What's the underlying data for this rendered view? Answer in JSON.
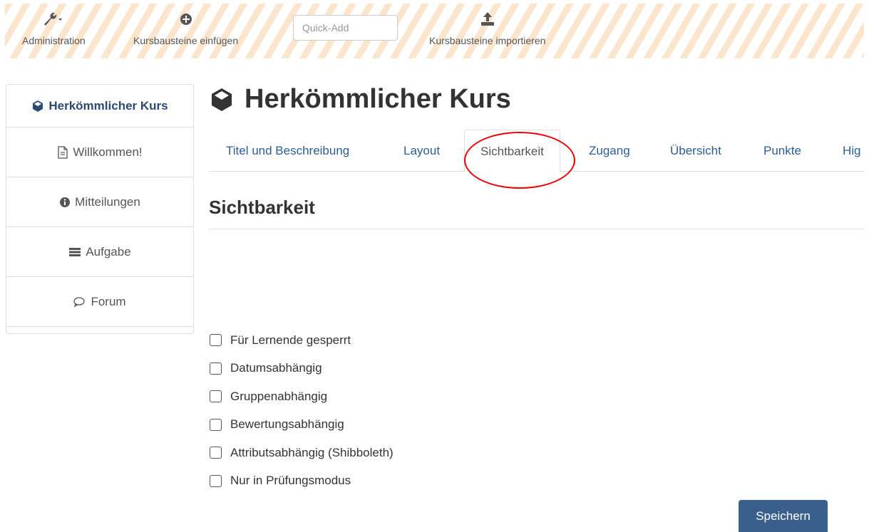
{
  "toolbar": {
    "administration_label": "Administration",
    "einfuegen_label": "Kursbausteine einfügen",
    "quickadd_placeholder": "Quick-Add",
    "importieren_label": "Kursbausteine importieren"
  },
  "sidebar": {
    "course_title": "Herkömmlicher Kurs",
    "items": [
      {
        "label": "Willkommen!",
        "icon": "document-icon"
      },
      {
        "label": "Mitteilungen",
        "icon": "info-icon"
      },
      {
        "label": "Aufgabe",
        "icon": "task-icon"
      },
      {
        "label": "Forum",
        "icon": "forum-icon"
      }
    ]
  },
  "main": {
    "title": "Herkömmlicher Kurs",
    "tabs": [
      {
        "label": "Titel und Beschreibung"
      },
      {
        "label": "Layout"
      },
      {
        "label": "Sichtbarkeit",
        "active": true
      },
      {
        "label": "Zugang"
      },
      {
        "label": "Übersicht"
      },
      {
        "label": "Punkte"
      },
      {
        "label": "Hig"
      }
    ],
    "section_title": "Sichtbarkeit",
    "checkboxes": [
      {
        "label": "Für Lernende gesperrt",
        "checked": false
      },
      {
        "label": "Datumsabhängig",
        "checked": false
      },
      {
        "label": "Gruppenabhängig",
        "checked": false
      },
      {
        "label": "Bewertungsabhängig",
        "checked": false
      },
      {
        "label": "Attributsabhängig (Shibboleth)",
        "checked": false
      },
      {
        "label": "Nur in Prüfungsmodus",
        "checked": false
      }
    ],
    "save_label": "Speichern"
  },
  "colors": {
    "accent": "#2c5d94",
    "button": "#3a5f8c",
    "highlight_circle": "#ee0000",
    "toolbar_stripe": "#fbe6cd"
  }
}
